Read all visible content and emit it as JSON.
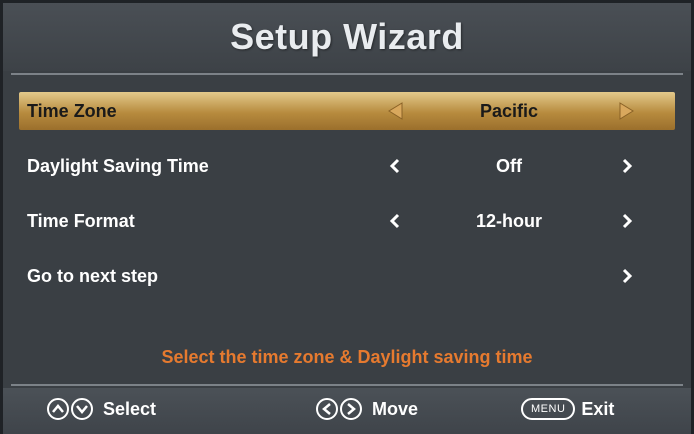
{
  "header": {
    "title": "Setup Wizard"
  },
  "rows": [
    {
      "label": "Time Zone",
      "value": "Pacific"
    },
    {
      "label": "Daylight Saving Time",
      "value": "Off"
    },
    {
      "label": "Time Format",
      "value": "12-hour"
    },
    {
      "label": "Go to next step",
      "value": ""
    }
  ],
  "hint": "Select the time zone & Daylight saving time",
  "footer": {
    "select_label": "Select",
    "move_label": "Move",
    "menu_key": "MENU",
    "exit_label": "Exit"
  },
  "colors": {
    "highlight": "#c59a4d",
    "hint": "#e67a2f"
  },
  "icons": {
    "up_down": "up-down-icon",
    "left_right": "left-right-icon",
    "menu": "menu-key-icon"
  }
}
